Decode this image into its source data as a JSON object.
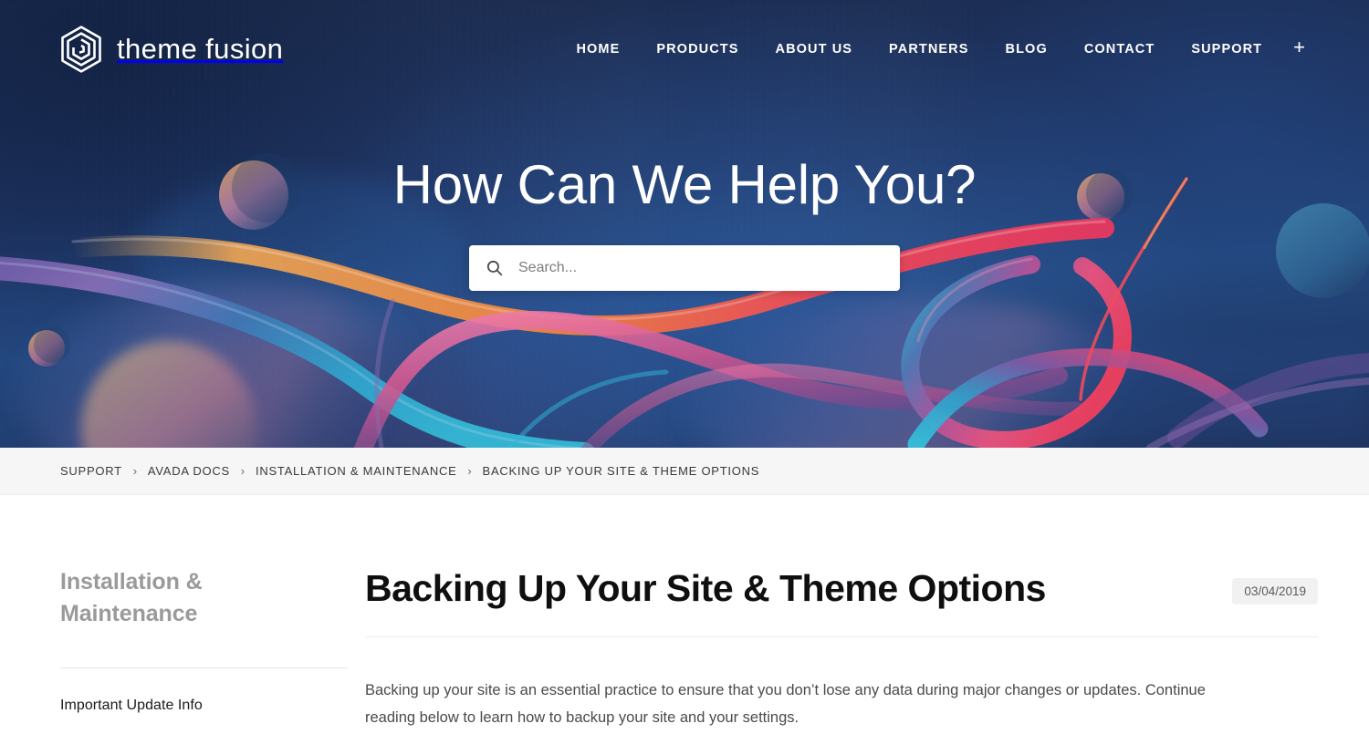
{
  "site": {
    "brand_name": "theme fusion",
    "logo_icon": "hexagon-spiral-logo-icon"
  },
  "colors": {
    "hero_navy": "#1b2c50",
    "hero_blue": "#23477f",
    "breadcrumb_bg": "#f6f6f6",
    "date_badge_bg": "#f1f1f1",
    "sidebar_title": "#9a9a9a",
    "body_text": "#4a4a4f",
    "ribbon_orange": "#f0924a",
    "ribbon_red": "#ef3f5e",
    "ribbon_pink": "#e06a9e",
    "ribbon_purple": "#7a5fa8",
    "ribbon_cyan": "#2fb6d8"
  },
  "nav": {
    "items": [
      {
        "label": "HOME"
      },
      {
        "label": "PRODUCTS"
      },
      {
        "label": "ABOUT US"
      },
      {
        "label": "PARTNERS"
      },
      {
        "label": "BLOG"
      },
      {
        "label": "CONTACT"
      },
      {
        "label": "SUPPORT"
      }
    ],
    "plus_label": "+",
    "plus_icon": "plus-icon"
  },
  "hero": {
    "title": "How Can We Help You?",
    "search": {
      "placeholder": "Search...",
      "value": "",
      "icon": "search-icon"
    }
  },
  "breadcrumb": {
    "separator": "›",
    "items": [
      {
        "label": "SUPPORT",
        "current": false
      },
      {
        "label": "AVADA DOCS",
        "current": false
      },
      {
        "label": "INSTALLATION & MAINTENANCE",
        "current": false
      },
      {
        "label": "BACKING UP YOUR SITE & THEME OPTIONS",
        "current": true
      }
    ]
  },
  "sidebar": {
    "title": "Installation & Maintenance",
    "links": [
      {
        "label": "Important Update Info"
      }
    ]
  },
  "article": {
    "title": "Backing Up Your Site & Theme Options",
    "date": "03/04/2019",
    "paragraphs": [
      "Backing up your site is an essential practice to ensure that you don’t lose any data during major changes or updates. Continue reading below to learn how to backup your site and your settings."
    ]
  }
}
